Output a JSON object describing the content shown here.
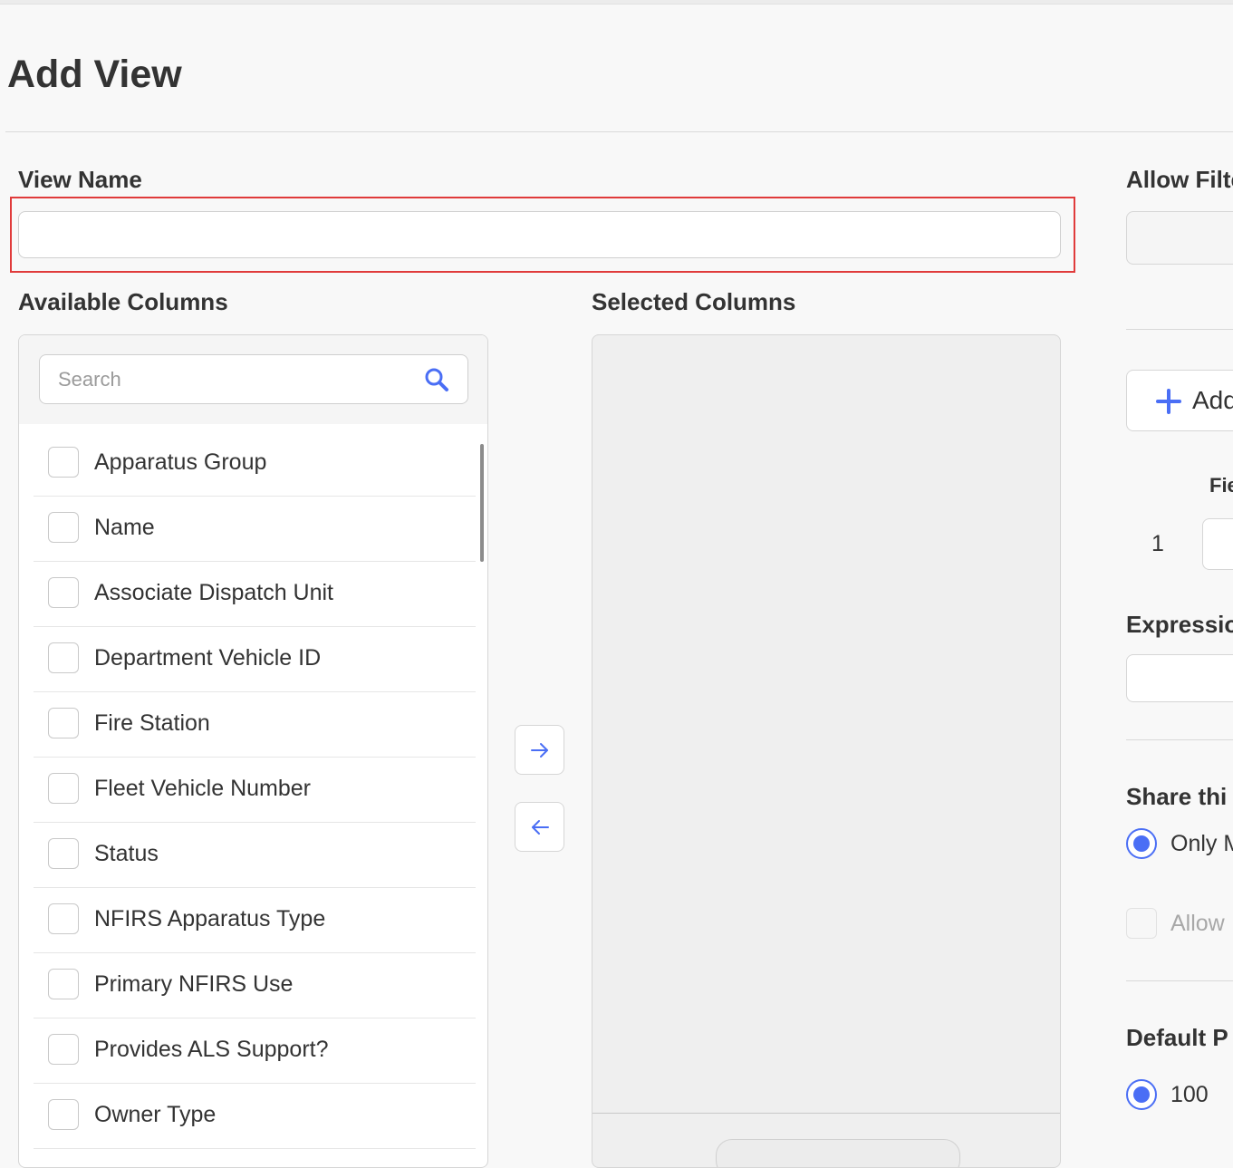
{
  "page": {
    "title": "Add View"
  },
  "view_name": {
    "label": "View Name",
    "value": ""
  },
  "available": {
    "label": "Available Columns",
    "search_placeholder": "Search",
    "items": [
      "Apparatus Group",
      "Name",
      "Associate Dispatch Unit",
      "Department Vehicle ID",
      "Fire Station",
      "Fleet Vehicle Number",
      "Status",
      "NFIRS Apparatus Type",
      "Primary NFIRS Use",
      "Provides ALS Support?",
      "Owner Type"
    ]
  },
  "selected": {
    "label": "Selected Columns"
  },
  "filters": {
    "label": "Allow Filte",
    "add_button_label": "Add",
    "field_header": "Fie",
    "row_number": "1",
    "expression_label": "Expressio"
  },
  "share": {
    "label": "Share thi",
    "option_label": "Only M",
    "allow_label": "Allow"
  },
  "default_page": {
    "label": "Default P",
    "option_label": "100"
  },
  "colors": {
    "accent": "#4a6ef5",
    "highlight": "#e03b3b"
  },
  "icons": {
    "search": "search-icon",
    "move_right": "arrow-right-icon",
    "move_left": "arrow-left-icon",
    "add": "plus-icon"
  }
}
